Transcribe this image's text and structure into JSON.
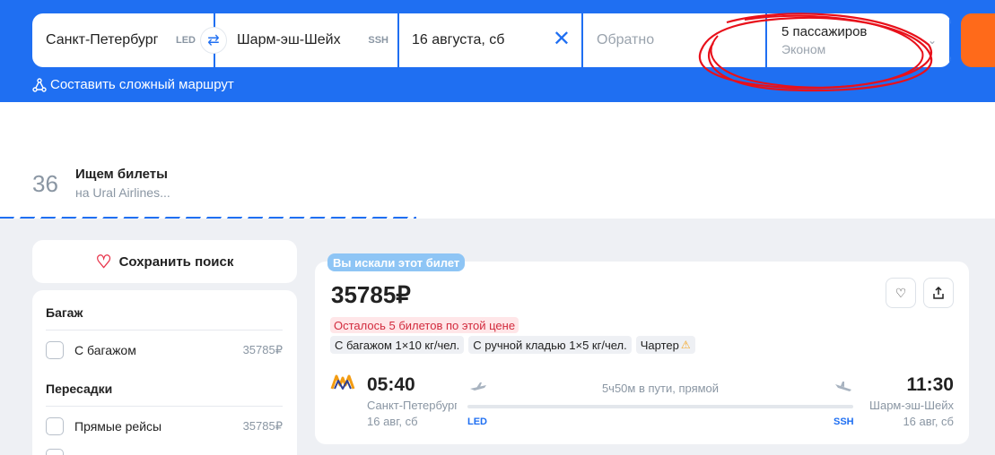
{
  "search": {
    "origin": "Санкт-Петербург",
    "origin_code": "LED",
    "destination": "Шарм-эш-Шейх",
    "destination_code": "SSH",
    "date": "16 августа, сб",
    "return_placeholder": "Обратно",
    "passengers": "5 пассажиров",
    "cabin_class": "Эконом",
    "complex_route": "Составить сложный маршрут"
  },
  "loading": {
    "count": "36",
    "title": "Ищем билеты",
    "subtitle": "на Ural Airlines..."
  },
  "sidebar": {
    "save_search": "Сохранить поиск",
    "baggage_heading": "Багаж",
    "with_baggage": "С багажом",
    "with_baggage_price": "35785₽",
    "transfers_heading": "Пересадки",
    "direct": "Прямые рейсы",
    "direct_price": "35785₽"
  },
  "ticket": {
    "searched_tag": "Вы искали этот билет",
    "price": "35785₽",
    "tickets_left": "Осталось 5 билетов по этой цене",
    "chips": [
      "С багажом 1×10 кг/чел.",
      "С ручной кладью 1×5 кг/чел.",
      "Чартер"
    ],
    "departure_time": "05:40",
    "departure_city": "Санкт-Петербург",
    "departure_date": "16 авг, сб",
    "departure_code": "LED",
    "duration": "5ч50м в пути, прямой",
    "arrival_time": "11:30",
    "arrival_city": "Шарм-эш-Шейх",
    "arrival_date": "16 авг, сб",
    "arrival_code": "SSH"
  },
  "colors": {
    "brand_blue": "#1f6ff2",
    "accent_orange": "#ff6a1a",
    "annotation_red": "#e8101a"
  },
  "icons": [
    "swap-icon",
    "clear-icon",
    "chevron-down-icon",
    "route-icon",
    "heart-icon",
    "favorite-icon",
    "share-icon",
    "airline-logo",
    "warning-icon",
    "plane-takeoff-icon",
    "plane-landing-icon"
  ]
}
